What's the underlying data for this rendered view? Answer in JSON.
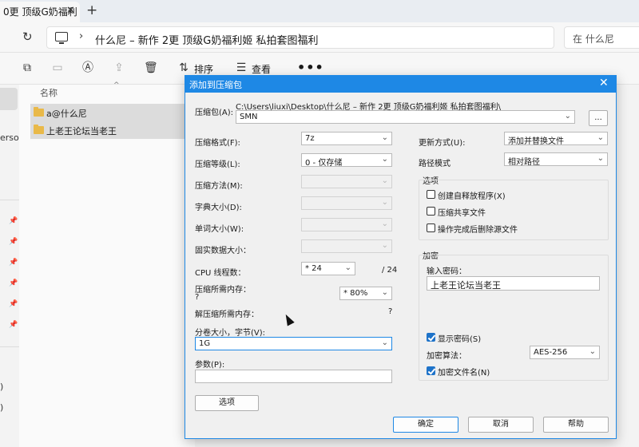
{
  "explorer": {
    "tab_title": "0更 顶级G奶福利",
    "address_crumb": "什么尼 – 新作 2更 顶级G奶福利姬 私拍套图福利",
    "search_placeholder": "在 什么尼",
    "toolbar": {
      "sort_label": "排序",
      "view_label": "查看",
      "more": "•••"
    },
    "column_name": "名称",
    "files": [
      {
        "name": "a@什么尼"
      },
      {
        "name": "上老王论坛当老王"
      }
    ],
    "nav_text": "ersor",
    "nav_paren_1": ")",
    "nav_paren_2": ")"
  },
  "dialog": {
    "title": "添加到压缩包",
    "archive_label": "压缩包(A):",
    "archive_path": "C:\\Users\\liuxi\\Desktop\\什么尼 – 新作 2更 顶级G奶福利姬 私拍套图福利\\",
    "archive_name": "SMN",
    "browse_label": "...",
    "left": {
      "format_label": "压缩格式(F):",
      "format_value": "7z",
      "level_label": "压缩等级(L):",
      "level_value": "0 - 仅存储",
      "method_label": "压缩方法(M):",
      "dict_label": "字典大小(D):",
      "word_label": "单词大小(W):",
      "solid_label": "固实数据大小：",
      "cpu_label": "CPU 线程数：",
      "cpu_value": "* 24",
      "cpu_total": "/ 24",
      "mem_comp_label": "压缩所需内存：",
      "mem_comp_q": "?",
      "mem_comp_value": "* 80%",
      "mem_decomp_label": "解压缩所需内存：",
      "mem_decomp_value": "?",
      "split_label": "分卷大小，字节(V):",
      "split_value": "1G",
      "params_label": "参数(P):",
      "params_value": "",
      "options_button": "选项"
    },
    "right": {
      "update_label": "更新方式(U):",
      "update_value": "添加并替换文件",
      "path_label": "路径模式",
      "path_value": "相对路径",
      "options_group": "选项",
      "opt_sfx": "创建自释放程序(X)",
      "opt_shared": "压缩共享文件",
      "opt_delete": "操作完成后删除源文件",
      "encrypt_group": "加密",
      "password_label": "输入密码：",
      "password_value": "上老王论坛当老王",
      "show_password": "显示密码(S)",
      "algo_label": "加密算法：",
      "algo_value": "AES-256",
      "encrypt_names": "加密文件名(N)"
    },
    "buttons": {
      "ok": "确定",
      "cancel": "取消",
      "help": "帮助"
    }
  }
}
